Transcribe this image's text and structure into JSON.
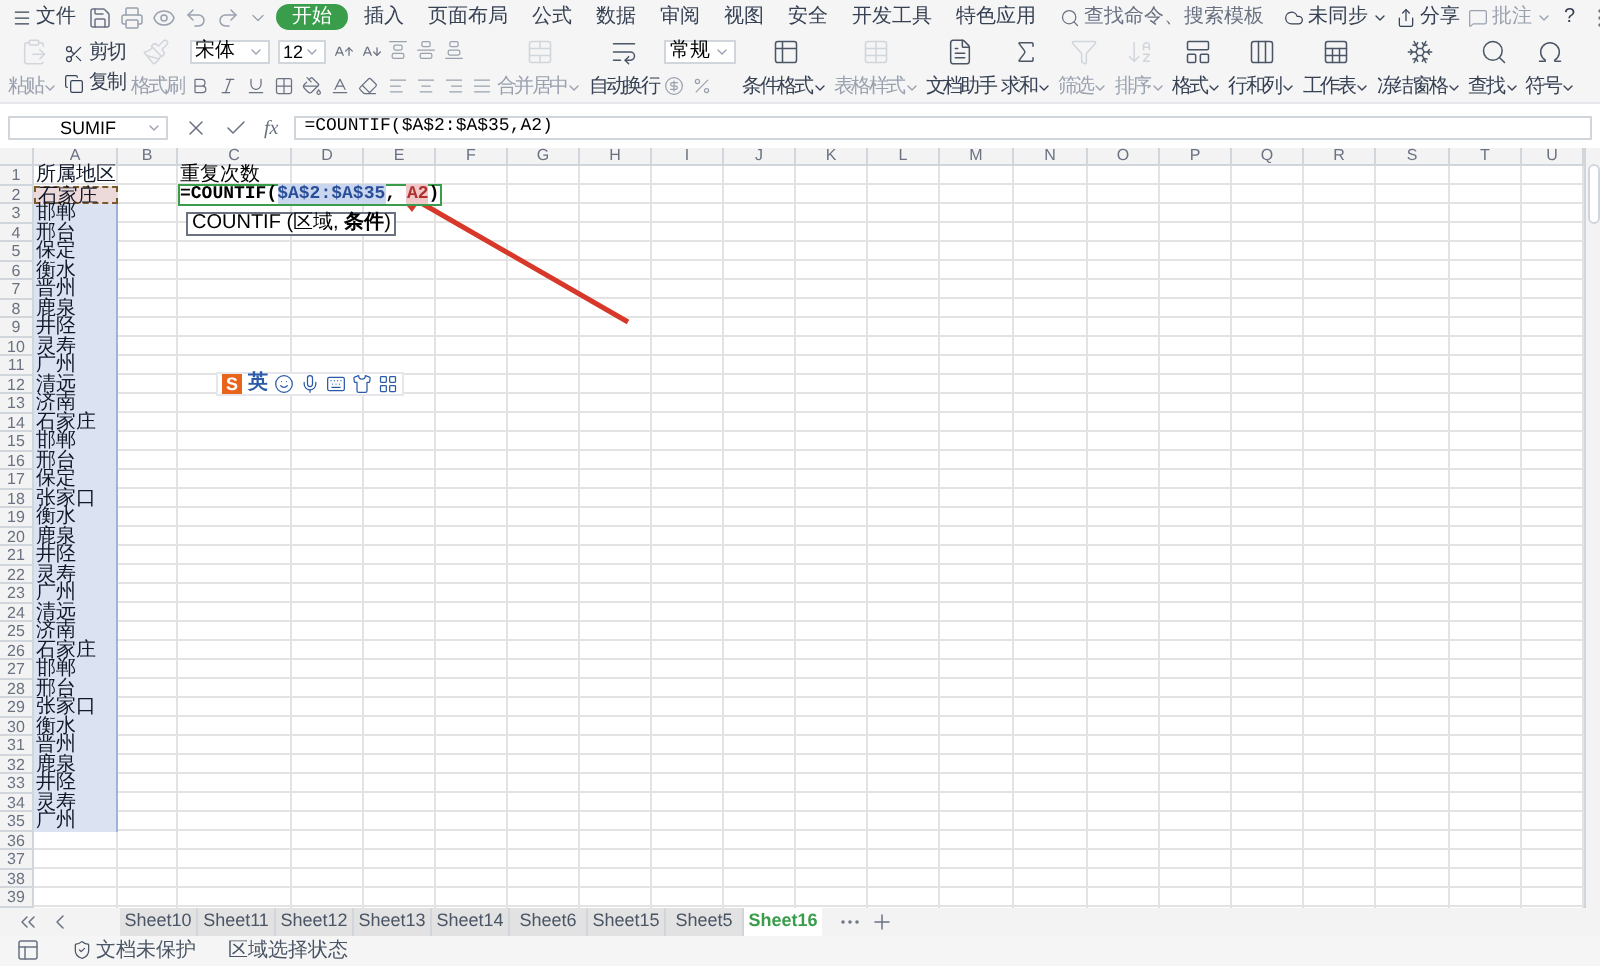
{
  "menu": {
    "menu_label": "文件",
    "tabs": [
      {
        "label": "开始",
        "selected": true
      },
      {
        "label": "插入",
        "selected": false
      },
      {
        "label": "页面布局",
        "selected": false
      },
      {
        "label": "公式",
        "selected": false
      },
      {
        "label": "数据",
        "selected": false
      },
      {
        "label": "审阅",
        "selected": false
      },
      {
        "label": "视图",
        "selected": false
      },
      {
        "label": "安全",
        "selected": false
      },
      {
        "label": "开发工具",
        "selected": false
      },
      {
        "label": "特色应用",
        "selected": false
      }
    ],
    "search": {
      "placeholder": "查找命令、搜索模板"
    },
    "sync": "未同步",
    "share": "分享",
    "comment": {
      "label": "批注",
      "disabled": true
    },
    "help": "?"
  },
  "ribbon": {
    "paste": {
      "label": "粘贴",
      "disabled": true
    },
    "cut": "剪切",
    "copy": "复制",
    "format_painter": {
      "label": "格式刷",
      "disabled": true
    },
    "font": {
      "name": "宋体",
      "size": "12"
    },
    "merge": {
      "label": "合并居中",
      "disabled": true
    },
    "wrap": {
      "label": "自动换行",
      "disabled": false
    },
    "number_format": "常规",
    "tools": [
      {
        "label": "条件格式",
        "dropdown": true,
        "disabled": false
      },
      {
        "label": "表格样式",
        "dropdown": true,
        "disabled": true
      },
      {
        "label": "文档助手",
        "dropdown": false,
        "disabled": false
      },
      {
        "label": "求和",
        "dropdown": true,
        "disabled": false
      },
      {
        "label": "筛选",
        "dropdown": true,
        "disabled": true
      },
      {
        "label": "排序",
        "dropdown": true,
        "disabled": true
      },
      {
        "label": "格式",
        "dropdown": true,
        "disabled": false
      },
      {
        "label": "行和列",
        "dropdown": true,
        "disabled": false
      },
      {
        "label": "工作表",
        "dropdown": true,
        "disabled": false
      },
      {
        "label": "冻结窗格",
        "dropdown": true,
        "disabled": false
      },
      {
        "label": "查找",
        "dropdown": true,
        "disabled": false
      },
      {
        "label": "符号",
        "dropdown": true,
        "disabled": false
      }
    ]
  },
  "formula_bar": {
    "name_box": "SUMIF",
    "fx_label": "fx",
    "formula": "=COUNTIF($A$2:$A$35,A2)"
  },
  "columns": [
    "A",
    "B",
    "C",
    "D",
    "E",
    "F",
    "G",
    "H",
    "I",
    "J",
    "K",
    "L",
    "M",
    "N",
    "O",
    "P",
    "Q",
    "R",
    "S",
    "T",
    "U"
  ],
  "rows": [
    {
      "number": "1",
      "a": "所属地区",
      "c": "重复次数",
      "in_range": false,
      "ref": false
    },
    {
      "number": "2",
      "a": "石家庄",
      "in_range": true,
      "ref": true,
      "formula_parts": [
        {
          "text": "=COUNTIF(",
          "kind": "plain"
        },
        {
          "text": "$A$2:$A$35",
          "kind": "range"
        },
        {
          "text": ", ",
          "kind": "plain"
        },
        {
          "text": "A2",
          "kind": "ref"
        },
        {
          "text": ")",
          "kind": "plain"
        }
      ]
    },
    {
      "number": "3",
      "a": "邯郸",
      "in_range": true,
      "ref": false
    },
    {
      "number": "4",
      "a": "邢台",
      "in_range": true,
      "ref": false
    },
    {
      "number": "5",
      "a": "保定",
      "in_range": true,
      "ref": false
    },
    {
      "number": "6",
      "a": "衡水",
      "in_range": true,
      "ref": false
    },
    {
      "number": "7",
      "a": "晋州",
      "in_range": true,
      "ref": false
    },
    {
      "number": "8",
      "a": "鹿泉",
      "in_range": true,
      "ref": false
    },
    {
      "number": "9",
      "a": "井陉",
      "in_range": true,
      "ref": false
    },
    {
      "number": "10",
      "a": "灵寿",
      "in_range": true,
      "ref": false
    },
    {
      "number": "11",
      "a": "广州",
      "in_range": true,
      "ref": false
    },
    {
      "number": "12",
      "a": "清远",
      "in_range": true,
      "ref": false
    },
    {
      "number": "13",
      "a": "济南",
      "in_range": true,
      "ref": false
    },
    {
      "number": "14",
      "a": "石家庄",
      "in_range": true,
      "ref": false
    },
    {
      "number": "15",
      "a": "邯郸",
      "in_range": true,
      "ref": false
    },
    {
      "number": "16",
      "a": "邢台",
      "in_range": true,
      "ref": false
    },
    {
      "number": "17",
      "a": "保定",
      "in_range": true,
      "ref": false
    },
    {
      "number": "18",
      "a": "张家口",
      "in_range": true,
      "ref": false
    },
    {
      "number": "19",
      "a": "衡水",
      "in_range": true,
      "ref": false
    },
    {
      "number": "20",
      "a": "鹿泉",
      "in_range": true,
      "ref": false
    },
    {
      "number": "21",
      "a": "井陉",
      "in_range": true,
      "ref": false
    },
    {
      "number": "22",
      "a": "灵寿",
      "in_range": true,
      "ref": false
    },
    {
      "number": "23",
      "a": "广州",
      "in_range": true,
      "ref": false
    },
    {
      "number": "24",
      "a": "清远",
      "in_range": true,
      "ref": false
    },
    {
      "number": "25",
      "a": "济南",
      "in_range": true,
      "ref": false
    },
    {
      "number": "26",
      "a": "石家庄",
      "in_range": true,
      "ref": false
    },
    {
      "number": "27",
      "a": "邯郸",
      "in_range": true,
      "ref": false
    },
    {
      "number": "28",
      "a": "邢台",
      "in_range": true,
      "ref": false
    },
    {
      "number": "29",
      "a": "张家口",
      "in_range": true,
      "ref": false
    },
    {
      "number": "30",
      "a": "衡水",
      "in_range": true,
      "ref": false
    },
    {
      "number": "31",
      "a": "晋州",
      "in_range": true,
      "ref": false
    },
    {
      "number": "32",
      "a": "鹿泉",
      "in_range": true,
      "ref": false
    },
    {
      "number": "33",
      "a": "井陉",
      "in_range": true,
      "ref": false
    },
    {
      "number": "34",
      "a": "灵寿",
      "in_range": true,
      "ref": false
    },
    {
      "number": "35",
      "a": "广州",
      "in_range": true,
      "ref": false
    },
    {
      "number": "36",
      "in_range": false,
      "ref": false
    },
    {
      "number": "37",
      "in_range": false,
      "ref": false
    },
    {
      "number": "38",
      "in_range": false,
      "ref": false
    },
    {
      "number": "39",
      "in_range": false,
      "ref": false
    }
  ],
  "function_tooltip": "COUNTIF (区域, **条件**)",
  "ime_toolbar": {
    "logo": "S",
    "mode": "英"
  },
  "sheet_tabs": [
    {
      "label": "Sheet10",
      "selected": false
    },
    {
      "label": "Sheet11",
      "selected": false
    },
    {
      "label": "Sheet12",
      "selected": false
    },
    {
      "label": "Sheet13",
      "selected": false
    },
    {
      "label": "Sheet14",
      "selected": false
    },
    {
      "label": "Sheet6",
      "selected": false
    },
    {
      "label": "Sheet15",
      "selected": false
    },
    {
      "label": "Sheet5",
      "selected": false
    },
    {
      "label": "Sheet16",
      "selected": true
    }
  ],
  "status_bar": {
    "protection": "文档未保护",
    "mode": "区域选择状态"
  }
}
